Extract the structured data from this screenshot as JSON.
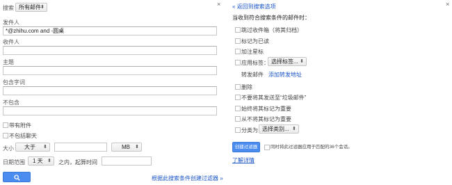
{
  "left": {
    "close": "×",
    "search_label": "搜索",
    "scope_value": "所有邮件",
    "from_label": "发件人",
    "from_value": "*@zhihu.com and -圆桌",
    "to_label": "收件人",
    "subject_label": "主题",
    "has_words_label": "包含字词",
    "no_words_label": "不包含",
    "has_attachment_label": "带有附件",
    "no_chats_label": "不包括聊天",
    "size_label": "大小",
    "size_op": "大于",
    "size_unit": "MB",
    "date_label": "日期范围",
    "date_value": "1 天",
    "date_suffix": "之内，起算时间",
    "create_filter_link": "根据此搜索条件创建过滤器 »"
  },
  "right": {
    "close": "×",
    "back_link": "« 返回到搜索选项",
    "heading": "当收到符合搜索条件的邮件时：",
    "options": [
      "跳过收件箱（将其归档）",
      "标记为已读",
      "加注星标",
      "应用标签：",
      "转发邮件",
      "删除",
      "不要将其发送至“垃圾邮件”",
      "始终将其标记为重要",
      "从不将其标记为重要",
      "分类为："
    ],
    "label_select": "选择标签...",
    "forward_link": "添加转发地址",
    "category_select": "选择类别...",
    "create_button": "创建过滤器",
    "apply_also": "同时将此过滤器应用于匹配的36个会话。",
    "learn_more": "了解详情"
  },
  "colors": {
    "accent": "#4a8cf0",
    "link": "#1a55c9"
  }
}
